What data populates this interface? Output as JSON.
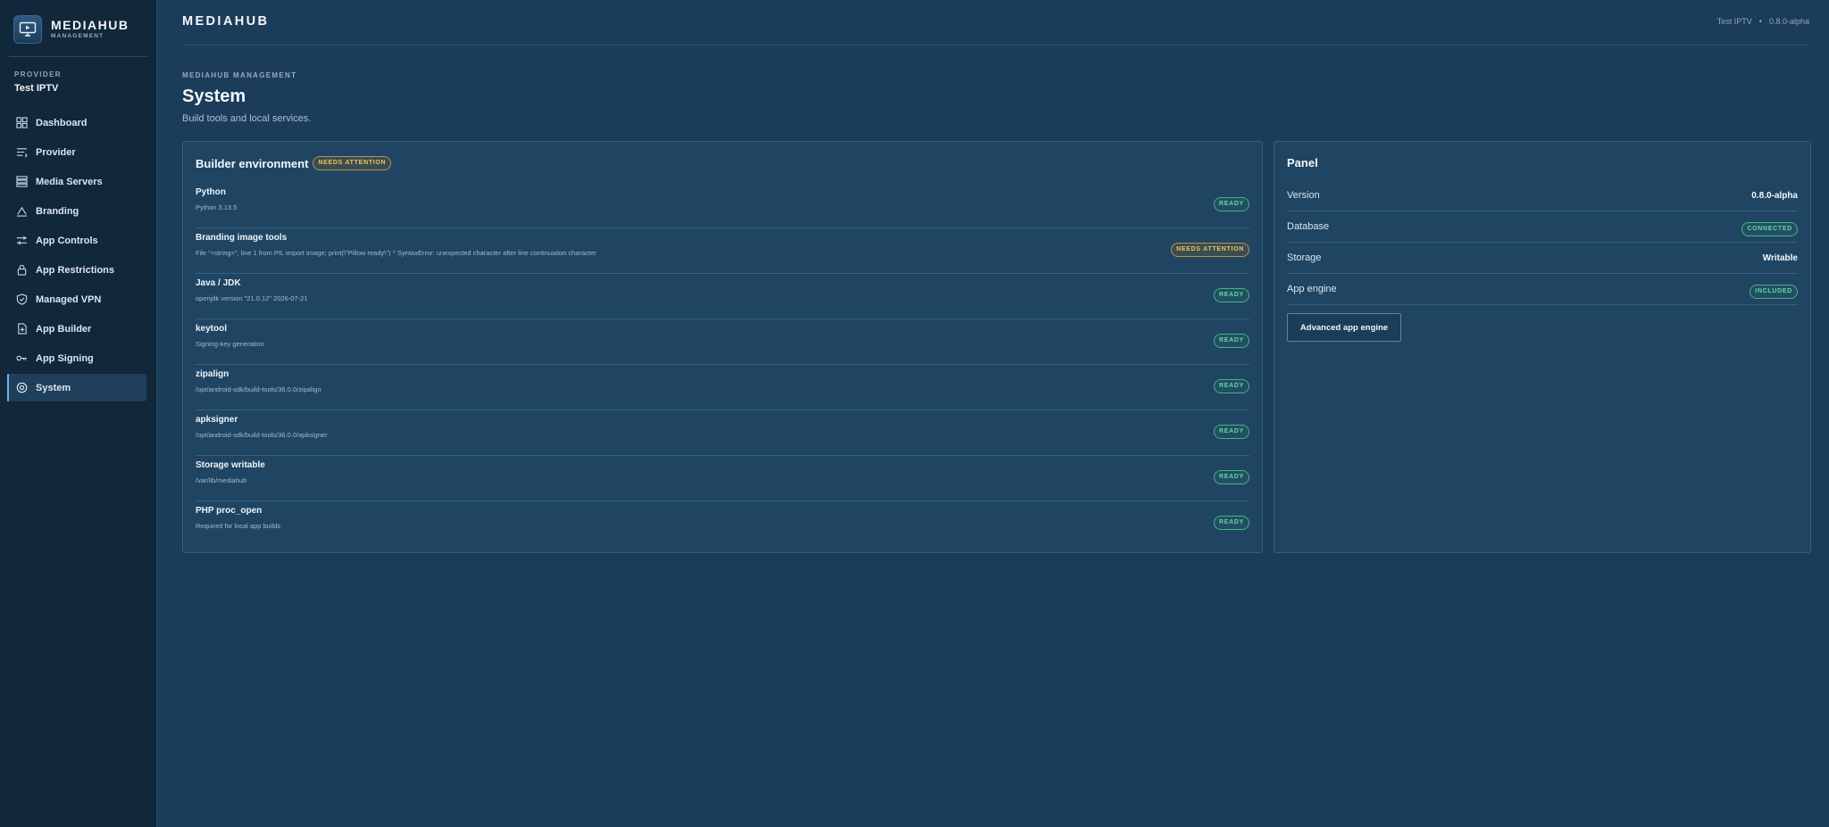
{
  "brand": {
    "name": "MEDIAHUB",
    "sub": "MANAGEMENT"
  },
  "provider": {
    "label": "PROVIDER",
    "name": "Test IPTV"
  },
  "nav": [
    {
      "label": "Dashboard",
      "icon": "grid-icon"
    },
    {
      "label": "Provider",
      "icon": "list-icon"
    },
    {
      "label": "Media Servers",
      "icon": "server-icon"
    },
    {
      "label": "Branding",
      "icon": "brush-icon"
    },
    {
      "label": "App Controls",
      "icon": "sliders-icon"
    },
    {
      "label": "App Restrictions",
      "icon": "lock-icon"
    },
    {
      "label": "Managed VPN",
      "icon": "shield-icon"
    },
    {
      "label": "App Builder",
      "icon": "package-icon"
    },
    {
      "label": "App Signing",
      "icon": "key-icon"
    },
    {
      "label": "System",
      "icon": "gear-icon",
      "active": true
    }
  ],
  "topbar": {
    "title": "MEDIAHUB",
    "provider": "Test IPTV",
    "separator": "•",
    "version": "0.8.0-alpha"
  },
  "page": {
    "eyebrow": "MEDIAHUB MANAGEMENT",
    "title": "System",
    "subtitle": "Build tools and local services."
  },
  "builder": {
    "title": "Builder environment",
    "status": "NEEDS ATTENTION",
    "rows": [
      {
        "name": "Python",
        "detail": "Python 3.13.5",
        "status": "READY"
      },
      {
        "name": "Branding image tools",
        "detail": "File \"<string>\", line 1 from PIL import Image; print(\\\"Pillow ready\\\") ^ SyntaxError: unexpected character after line continuation character",
        "status": "NEEDS ATTENTION"
      },
      {
        "name": "Java / JDK",
        "detail": "openjdk version \"21.0.12\" 2026-07-21",
        "status": "READY"
      },
      {
        "name": "keytool",
        "detail": "Signing-key generation",
        "status": "READY"
      },
      {
        "name": "zipalign",
        "detail": "/opt/android-sdk/build-tools/36.0.0/zipalign",
        "status": "READY"
      },
      {
        "name": "apksigner",
        "detail": "/opt/android-sdk/build-tools/36.0.0/apksigner",
        "status": "READY"
      },
      {
        "name": "Storage writable",
        "detail": "/var/lib/mediahub",
        "status": "READY"
      },
      {
        "name": "PHP proc_open",
        "detail": "Required for local app builds",
        "status": "READY"
      }
    ]
  },
  "panel": {
    "title": "Panel",
    "rows": [
      {
        "label": "Version",
        "value": "0.8.0-alpha"
      },
      {
        "label": "Database",
        "badge": "CONNECTED"
      },
      {
        "label": "Storage",
        "value": "Writable"
      },
      {
        "label": "App engine",
        "badge": "INCLUDED"
      }
    ],
    "button": "Advanced app engine"
  },
  "colors": {
    "background": "#1b3d59",
    "sidebar": "#11273a",
    "ready": "#5fd8a4",
    "warning": "#f0c25c",
    "accent": "#6fb4e8"
  }
}
